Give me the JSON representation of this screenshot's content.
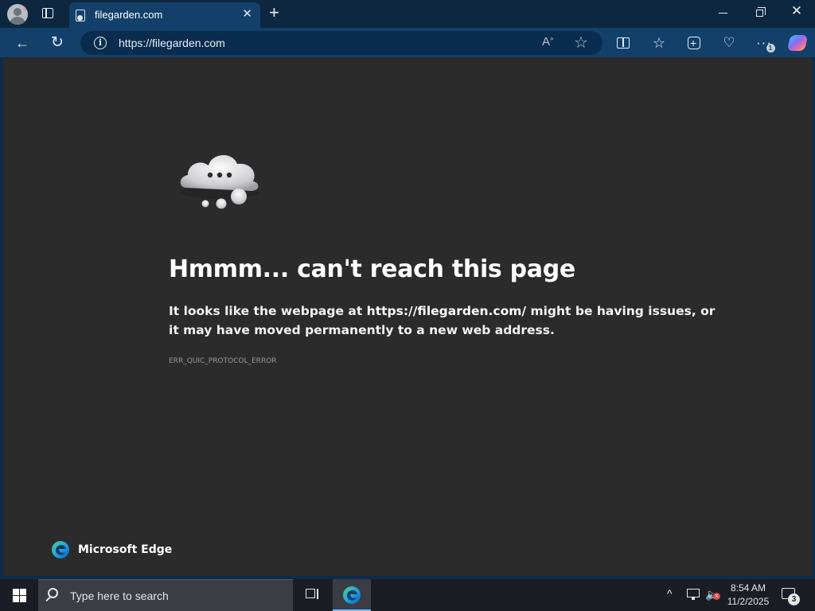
{
  "browser": {
    "tab": {
      "title": "filegarden.com",
      "close_glyph": "✕"
    },
    "new_tab_glyph": "+",
    "window_controls": {
      "close_glyph": "✕"
    },
    "toolbar": {
      "back_glyph": "←",
      "refresh_glyph": "↻",
      "info_glyph": "i",
      "url": "https://filegarden.com",
      "read_aloud_glyph": "A",
      "favorite_glyph": "☆",
      "favorites_glyph": "☆",
      "performance_glyph": "♡",
      "more_glyph": "···",
      "more_badge": "1"
    }
  },
  "error_page": {
    "heading": "Hmmm... can't reach this page",
    "message_prefix": "It looks like the webpage at ",
    "message_url": "https://filegarden.com/",
    "message_suffix": " might be having issues, or it may have moved permanently to a new web address.",
    "error_code": "ERR_QUIC_PROTOCOL_ERROR",
    "brand": "Microsoft Edge"
  },
  "taskbar": {
    "search_placeholder": "Type here to search",
    "chevron_glyph": "^",
    "volume_glyph": "🔈",
    "volume_muted_glyph": "x",
    "time": "8:54 AM",
    "date": "11/2/2025",
    "notification_count": "3"
  },
  "colors": {
    "tab_strip": "#0d2740",
    "toolbar": "#12406b",
    "page_background": "#2b2b2b",
    "taskbar": "#1a1d24",
    "edge_blue": "#0c74d4",
    "edge_green": "#4fd38a"
  },
  "icons": {
    "profile": "profile-avatar-icon",
    "tab_actions": "tab-actions-icon",
    "favicon": "document-globe-icon",
    "split_screen": "split-screen-icon",
    "favorites": "favorites-icon",
    "collections": "collections-icon",
    "performance": "browser-essentials-icon",
    "copilot": "copilot-icon",
    "cloud": "cloud-error-icon",
    "edge": "edge-logo-icon",
    "windows": "windows-start-icon",
    "search": "search-icon",
    "task_view": "task-view-icon",
    "network": "network-icon",
    "volume": "volume-muted-icon",
    "notifications": "notification-center-icon"
  }
}
